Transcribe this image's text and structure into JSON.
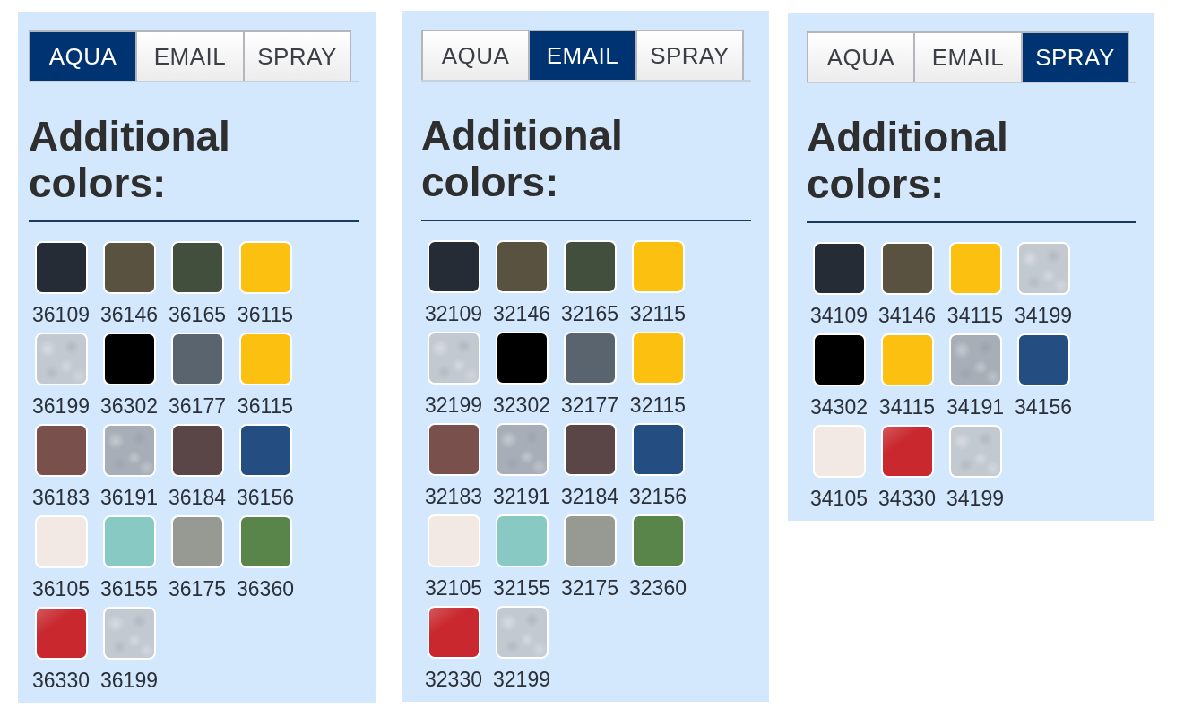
{
  "panels": [
    {
      "tabs": [
        {
          "label": "AQUA",
          "selected": true
        },
        {
          "label": "EMAIL",
          "selected": false
        },
        {
          "label": "SPRAY",
          "selected": false
        }
      ],
      "heading": "Additional colors:",
      "swatches": [
        {
          "code": "36109",
          "color": "#252c36",
          "kind": "solid"
        },
        {
          "code": "36146",
          "color": "#5a5240",
          "kind": "solid"
        },
        {
          "code": "36165",
          "color": "#434f3d",
          "kind": "solid"
        },
        {
          "code": "36115",
          "color": "#fcc010",
          "kind": "solid"
        },
        {
          "code": "36199",
          "color": "#c3c9d1",
          "kind": "metallic"
        },
        {
          "code": "36302",
          "color": "#000000",
          "kind": "solid"
        },
        {
          "code": "36177",
          "color": "#5a646e",
          "kind": "solid"
        },
        {
          "code": "36115",
          "color": "#fcc010",
          "kind": "solid"
        },
        {
          "code": "36183",
          "color": "#7a504c",
          "kind": "solid"
        },
        {
          "code": "36191",
          "color": "#a7aeb7",
          "kind": "metallic"
        },
        {
          "code": "36184",
          "color": "#5a4646",
          "kind": "solid"
        },
        {
          "code": "36156",
          "color": "#244d82",
          "kind": "solid"
        },
        {
          "code": "36105",
          "color": "#f2e9e4",
          "kind": "solid"
        },
        {
          "code": "36155",
          "color": "#88c9c3",
          "kind": "solid"
        },
        {
          "code": "36175",
          "color": "#979a93",
          "kind": "solid"
        },
        {
          "code": "36360",
          "color": "#5a854a",
          "kind": "solid"
        },
        {
          "code": "36330",
          "color": "#c8282e",
          "kind": "gloss"
        },
        {
          "code": "36199",
          "color": "#c3c9d1",
          "kind": "metallic"
        }
      ]
    },
    {
      "tabs": [
        {
          "label": "AQUA",
          "selected": false
        },
        {
          "label": "EMAIL",
          "selected": true
        },
        {
          "label": "SPRAY",
          "selected": false
        }
      ],
      "heading": "Additional colors:",
      "swatches": [
        {
          "code": "32109",
          "color": "#252c36",
          "kind": "solid"
        },
        {
          "code": "32146",
          "color": "#5a5240",
          "kind": "solid"
        },
        {
          "code": "32165",
          "color": "#434f3d",
          "kind": "solid"
        },
        {
          "code": "32115",
          "color": "#fcc010",
          "kind": "solid"
        },
        {
          "code": "32199",
          "color": "#c3c9d1",
          "kind": "metallic"
        },
        {
          "code": "32302",
          "color": "#000000",
          "kind": "solid"
        },
        {
          "code": "32177",
          "color": "#5a646e",
          "kind": "solid"
        },
        {
          "code": "32115",
          "color": "#fcc010",
          "kind": "solid"
        },
        {
          "code": "32183",
          "color": "#7a504c",
          "kind": "solid"
        },
        {
          "code": "32191",
          "color": "#a7aeb7",
          "kind": "metallic"
        },
        {
          "code": "32184",
          "color": "#5a4646",
          "kind": "solid"
        },
        {
          "code": "32156",
          "color": "#244d82",
          "kind": "solid"
        },
        {
          "code": "32105",
          "color": "#f2e9e4",
          "kind": "solid"
        },
        {
          "code": "32155",
          "color": "#88c9c3",
          "kind": "solid"
        },
        {
          "code": "32175",
          "color": "#979a93",
          "kind": "solid"
        },
        {
          "code": "32360",
          "color": "#5a854a",
          "kind": "solid"
        },
        {
          "code": "32330",
          "color": "#c8282e",
          "kind": "gloss"
        },
        {
          "code": "32199",
          "color": "#c3c9d1",
          "kind": "metallic"
        }
      ]
    },
    {
      "tabs": [
        {
          "label": "AQUA",
          "selected": false
        },
        {
          "label": "EMAIL",
          "selected": false
        },
        {
          "label": "SPRAY",
          "selected": true
        }
      ],
      "heading": "Additional colors:",
      "swatches": [
        {
          "code": "34109",
          "color": "#252c36",
          "kind": "solid"
        },
        {
          "code": "34146",
          "color": "#5a5240",
          "kind": "solid"
        },
        {
          "code": "34115",
          "color": "#fcc010",
          "kind": "solid"
        },
        {
          "code": "34199",
          "color": "#c3c9d1",
          "kind": "metallic"
        },
        {
          "code": "34302",
          "color": "#000000",
          "kind": "solid"
        },
        {
          "code": "34115",
          "color": "#fcc010",
          "kind": "solid"
        },
        {
          "code": "34191",
          "color": "#a7aeb7",
          "kind": "metallic"
        },
        {
          "code": "34156",
          "color": "#244d82",
          "kind": "solid"
        },
        {
          "code": "34105",
          "color": "#f2e9e4",
          "kind": "solid"
        },
        {
          "code": "34330",
          "color": "#c8282e",
          "kind": "gloss"
        },
        {
          "code": "34199",
          "color": "#c3c9d1",
          "kind": "metallic"
        }
      ]
    }
  ]
}
